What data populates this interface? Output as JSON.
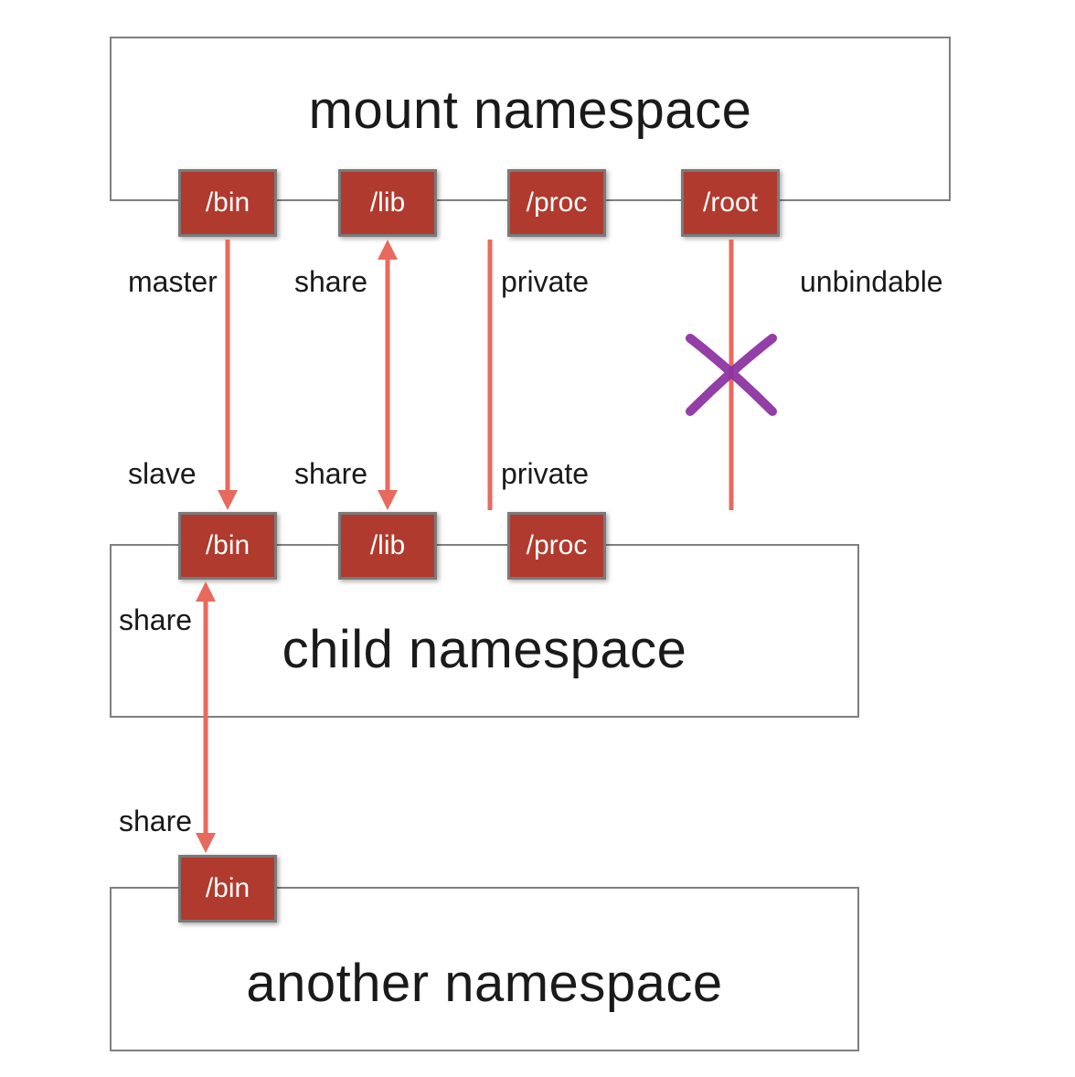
{
  "namespaces": {
    "mount": {
      "title": "mount namespace"
    },
    "child": {
      "title": "child namespace"
    },
    "another": {
      "title": "another namespace"
    }
  },
  "mounts": {
    "top": {
      "bin": "/bin",
      "lib": "/lib",
      "proc": "/proc",
      "root": "/root"
    },
    "child": {
      "bin": "/bin",
      "lib": "/lib",
      "proc": "/proc"
    },
    "another": {
      "bin": "/bin"
    }
  },
  "labels": {
    "bin_top": "master",
    "bin_bottom": "slave",
    "lib_top": "share",
    "lib_bottom": "share",
    "proc_top": "private",
    "proc_bottom": "private",
    "root": "unbindable",
    "child_bin_top": "share",
    "child_bin_bottom": "share"
  },
  "colors": {
    "box_fill": "#b03a2e",
    "box_border": "#7a7a7a",
    "ns_border": "#7f7f7f",
    "arrow": "#e86a5e",
    "xmark": "#8a2fa0"
  }
}
